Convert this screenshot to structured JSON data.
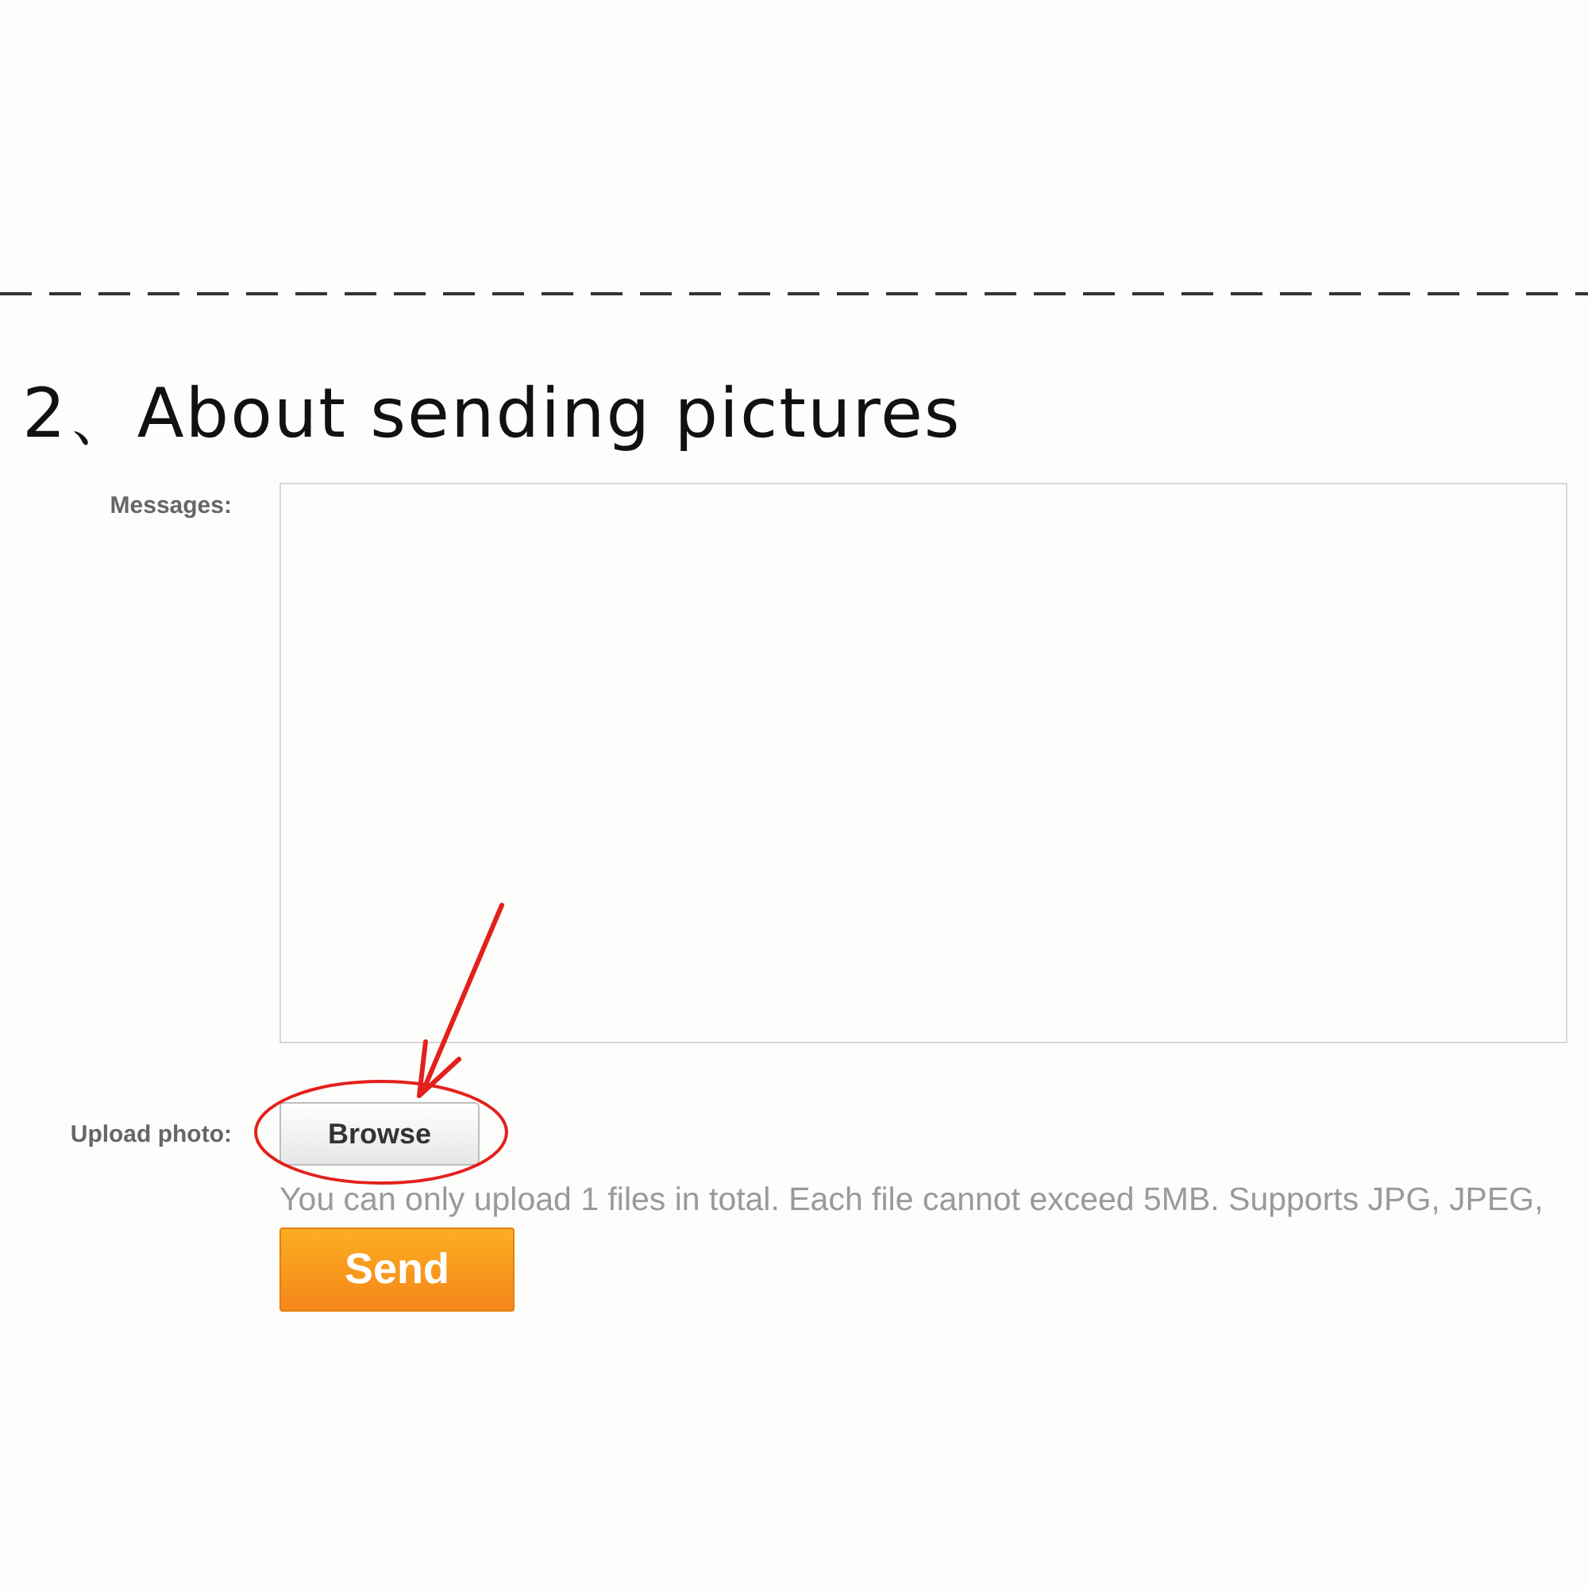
{
  "heading": "2、About sending pictures",
  "form": {
    "messages_label": "Messages:",
    "upload_label": "Upload photo:",
    "browse_button": "Browse",
    "hint": "You can only upload 1 files in total. Each file cannot exceed 5MB. Supports JPG, JPEG,",
    "send_button": "Send"
  }
}
